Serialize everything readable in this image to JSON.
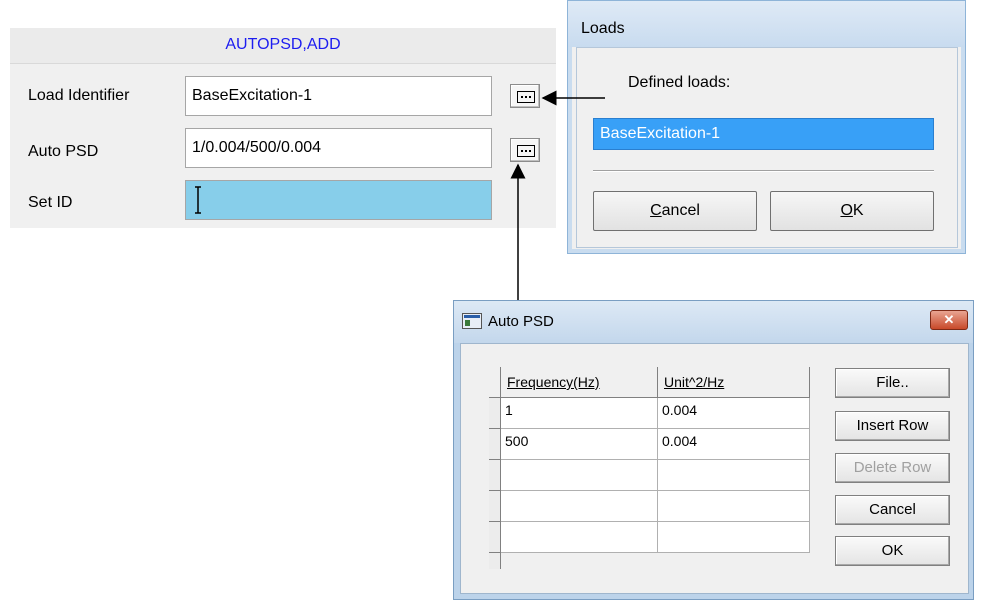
{
  "form": {
    "title": "AUTOPSD,ADD",
    "fields": [
      {
        "label": "Load Identifier",
        "value": "BaseExcitation-1"
      },
      {
        "label": "Auto PSD",
        "value": "1/0.004/500/0.004"
      },
      {
        "label": "Set ID",
        "value": ""
      }
    ]
  },
  "loads_dialog": {
    "title": "Loads",
    "list_label": "Defined loads:",
    "items": [
      "BaseExcitation-1"
    ],
    "cancel_label": "Cancel",
    "ok_label": "OK"
  },
  "psd_dialog": {
    "title": "Auto PSD",
    "close_glyph": "✕",
    "columns": [
      "Frequency(Hz)",
      "Unit^2/Hz"
    ],
    "rows": [
      [
        "1",
        "0.004"
      ],
      [
        "500",
        "0.004"
      ],
      [
        "",
        ""
      ],
      [
        "",
        ""
      ],
      [
        "",
        ""
      ]
    ],
    "buttons": {
      "file": "File..",
      "insert_row": "Insert Row",
      "delete_row": "Delete Row",
      "cancel": "Cancel",
      "ok": "OK"
    }
  },
  "colors": {
    "title_text": "#1d1df0",
    "selection": "#38a0f7",
    "active_input": "#87ceea"
  }
}
